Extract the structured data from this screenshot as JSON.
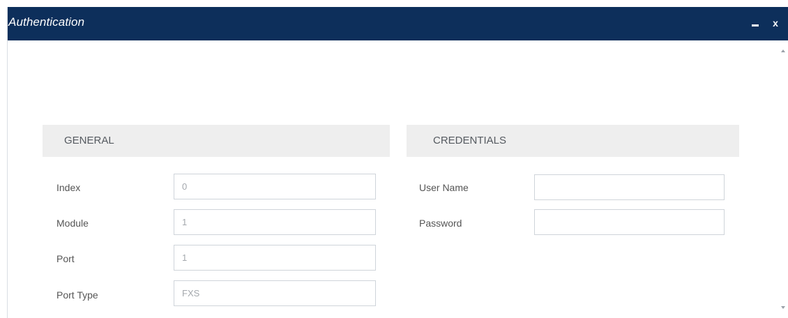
{
  "window": {
    "title": "Authentication",
    "controls": {
      "minimize": "minimize-icon",
      "close": "x"
    }
  },
  "general": {
    "header": "GENERAL",
    "fields": [
      {
        "label": "Index",
        "value": "0"
      },
      {
        "label": "Module",
        "value": "1"
      },
      {
        "label": "Port",
        "value": "1"
      },
      {
        "label": "Port Type",
        "value": "FXS"
      }
    ]
  },
  "credentials": {
    "header": "CREDENTIALS",
    "fields": [
      {
        "label": "User Name",
        "value": ""
      },
      {
        "label": "Password",
        "value": ""
      }
    ]
  },
  "colors": {
    "titlebar": "#0d2f5b",
    "section_header_bg": "#eeeeee",
    "field_border": "#cfd4da"
  }
}
